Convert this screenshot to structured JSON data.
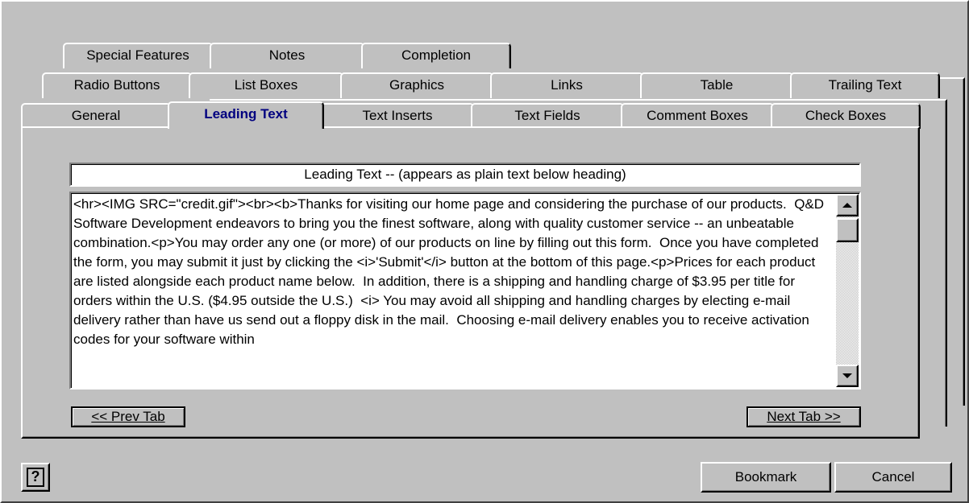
{
  "tabs": {
    "row1": [
      "Special Features",
      "Notes",
      "Completion"
    ],
    "row2": [
      "Radio Buttons",
      "List Boxes",
      "Graphics",
      "Links",
      "Table",
      "Trailing Text"
    ],
    "row3": [
      "General",
      "Leading Text",
      "Text Inserts",
      "Text Fields",
      "Comment Boxes",
      "Check Boxes"
    ],
    "selected": "Leading Text"
  },
  "content": {
    "title_label": "Leading Text -- (appears as plain text below heading)",
    "body_text": "<hr><IMG SRC=\"credit.gif\"><br><b>Thanks for visiting our home page and considering the purchase of our products.  Q&D Software Development endeavors to bring you the finest software, along with quality customer service -- an unbeatable combination.<p>You may order any one (or more) of our products on line by filling out this form.  Once you have completed the form, you may submit it just by clicking the <i>'Submit'</i> button at the bottom of this page.<p>Prices for each product are listed alongside each product name below.  In addition, there is a shipping and handling charge of $3.95 per title for orders within the U.S. ($4.95 outside the U.S.)  <i> You may avoid all shipping and handling charges by electing e-mail delivery rather than have us send out a floppy disk in the mail.  Choosing e-mail delivery enables you to receive activation codes for your software within"
  },
  "nav": {
    "prev_label": "<< Prev Tab",
    "next_label": "Next Tab >>"
  },
  "footer": {
    "help_label": "?",
    "bookmark_label": "Bookmark",
    "cancel_label": "Cancel"
  },
  "colors": {
    "face": "#c0c0c0",
    "selected_tab_text": "#00007f"
  }
}
